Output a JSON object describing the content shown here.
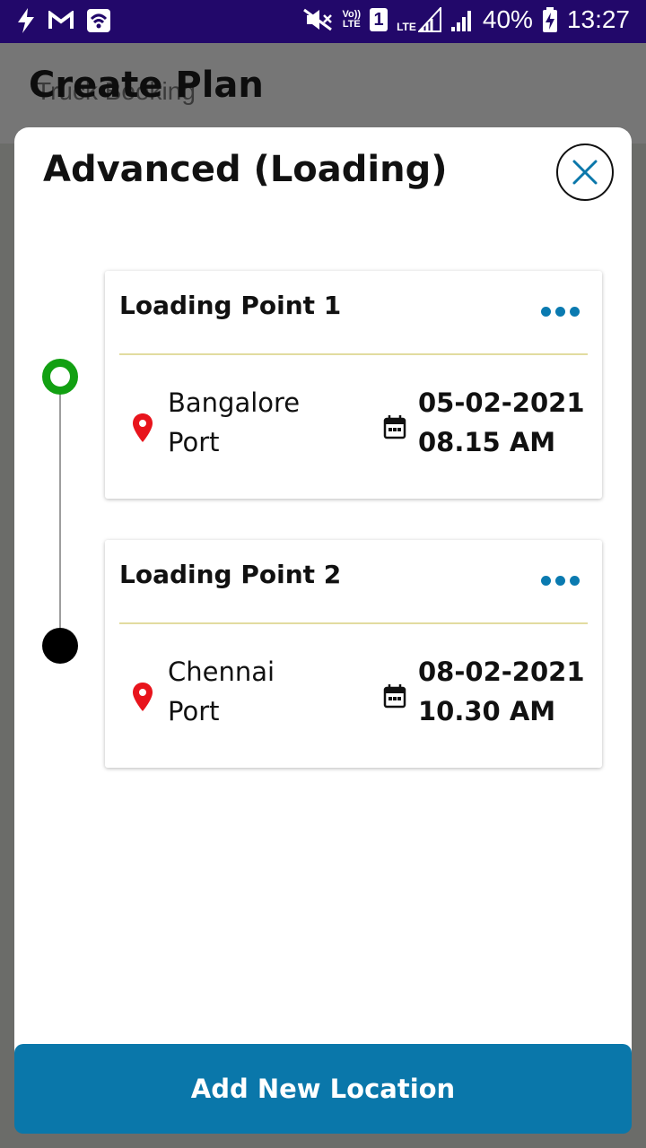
{
  "status_bar": {
    "battery": "40%",
    "time": "13:27",
    "volte_top": "Vo))",
    "volte_bottom": "LTE",
    "sim": "1",
    "lte": "LTE",
    "icons": [
      "flash-icon",
      "gmail-icon",
      "wifi-icon",
      "mute-icon",
      "signal-icon",
      "battery-charging-icon"
    ]
  },
  "background": {
    "title": "Create Plan",
    "subtitle": "Truck Booking"
  },
  "modal": {
    "title": "Advanced (Loading)",
    "close_icon": "close-icon"
  },
  "colors": {
    "accent": "#0a77aa",
    "start_marker": "#12a012",
    "pin": "#e8141c",
    "divider": "#e2dca0",
    "status_bar": "#22086a"
  },
  "loading_points": [
    {
      "title": "Loading Point 1",
      "location_line1": "Bangalore",
      "location_line2": "Port",
      "date": "05-02-2021",
      "time": "08.15 AM"
    },
    {
      "title": "Loading Point 2",
      "location_line1": "Chennai",
      "location_line2": "Port",
      "date": "08-02-2021",
      "time": "10.30 AM"
    }
  ],
  "footer": {
    "add_button_label": "Add New Location"
  }
}
